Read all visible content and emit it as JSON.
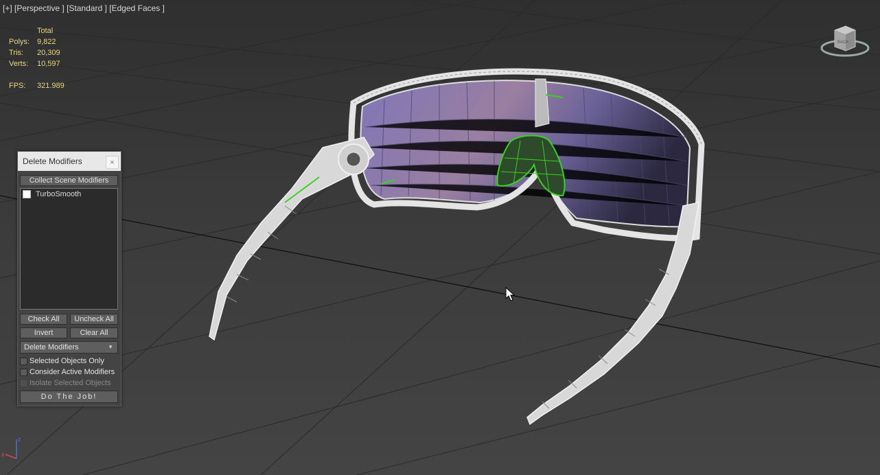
{
  "viewport": {
    "label_parts": [
      "[+]",
      "[Perspective ]",
      "[Standard ]",
      "[Edged Faces ]"
    ]
  },
  "stats": {
    "header": "Total",
    "rows": [
      {
        "key": "Polys:",
        "value": "9,822"
      },
      {
        "key": "Tris:",
        "value": "20,309"
      },
      {
        "key": "Verts:",
        "value": "10,597"
      }
    ],
    "fps_key": "FPS:",
    "fps_value": "321.989"
  },
  "viewcube": {
    "face_label": "BACK"
  },
  "axis": {
    "z": "z",
    "x": "x"
  },
  "dialog": {
    "title": "Delete Modifiers",
    "close_label": "×",
    "collect_label": "Collect Scene Modifiers",
    "list_items": [
      {
        "label": "TurboSmooth",
        "checked": false
      }
    ],
    "check_all_label": "Check All",
    "uncheck_all_label": "Uncheck All",
    "invert_label": "Invert",
    "clear_all_label": "Clear All",
    "mode_value": "Delete Modifiers",
    "options": {
      "selected_only": "Selected Objects Only",
      "consider_active": "Consider Active Modifiers",
      "isolate_selected": "Isolate Selected Objects"
    },
    "do_job_label": "Do The Job!"
  },
  "colors": {
    "background": "#3a3a3a",
    "stats_text": "#e8d880",
    "wire_highlight": "#39d11f",
    "lens": "#6f6aa3"
  }
}
